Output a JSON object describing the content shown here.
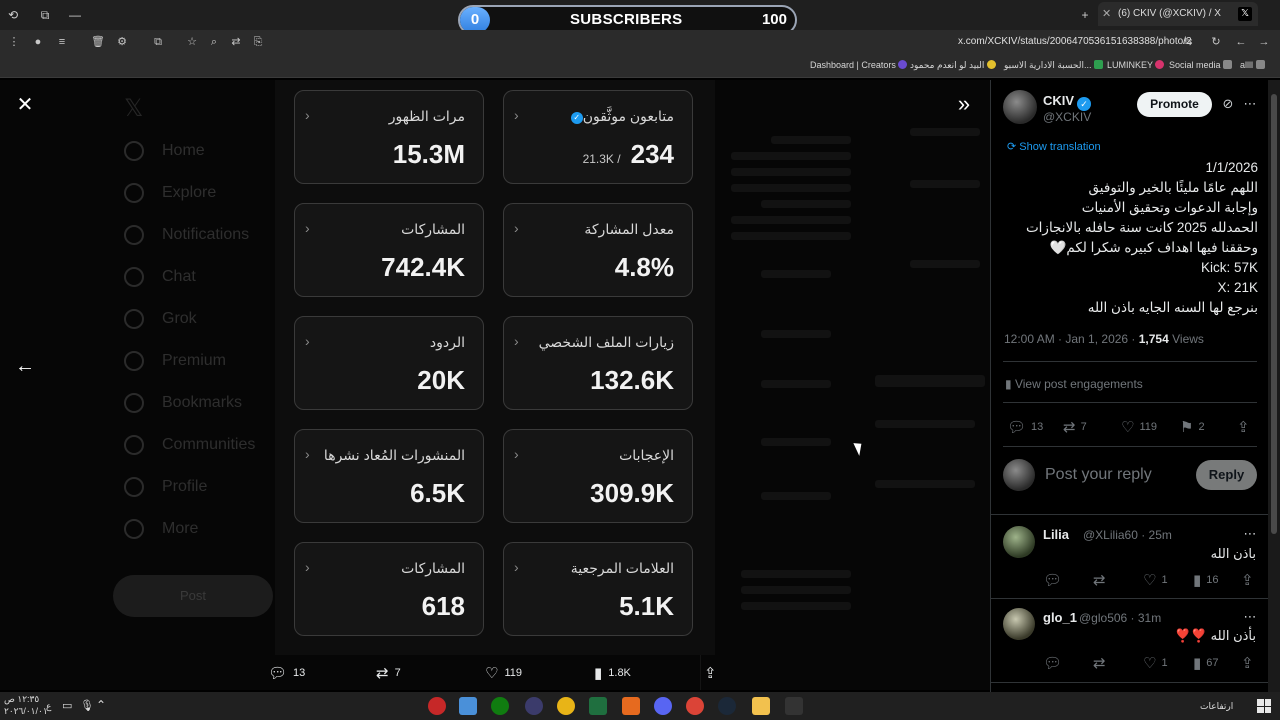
{
  "browser": {
    "subscribers": {
      "count_left": "0",
      "label": "SUBSCRIBERS",
      "count_right": "100"
    },
    "tab_title": "(6) CKIV (@XCKIV) / X",
    "url": "x.com/XCKIV/status/2006470536151638388/photo/2",
    "bookmarks": [
      "Dashboard | Creators",
      "البيد لو انعدم محمود",
      "الحسبة الادارية الاسبو...",
      "LUMINKEY",
      "Social media",
      "allll"
    ]
  },
  "dim_nav": {
    "items": [
      "Home",
      "Explore",
      "Notifications",
      "Chat",
      "Grok",
      "Premium",
      "Bookmarks",
      "Communities",
      "Profile",
      "More"
    ],
    "post_label": "Post"
  },
  "stats": {
    "cards": [
      {
        "label": "مرات الظهور",
        "value": "15.3M"
      },
      {
        "label": "متابعون موثَّقون",
        "value": "234",
        "sub": "21.3K /"
      },
      {
        "label": "المشاركات",
        "value": "742.4K"
      },
      {
        "label": "معدل المشاركة",
        "value": "4.8%"
      },
      {
        "label": "الردود",
        "value": "20K"
      },
      {
        "label": "زيارات الملف الشخصي",
        "value": "132.6K"
      },
      {
        "label": "المنشورات المُعاد نشرها",
        "value": "6.5K"
      },
      {
        "label": "الإعجابات",
        "value": "309.9K"
      },
      {
        "label": "المشاركات",
        "value": "618"
      },
      {
        "label": "العلامات المرجعية",
        "value": "5.1K"
      }
    ]
  },
  "modal_actions": {
    "replies": "13",
    "reposts": "7",
    "likes": "119",
    "views": "1.8K"
  },
  "tweet": {
    "author_name": "CKIV",
    "author_handle": "@XCKIV",
    "promote_label": "Promote",
    "show_translation": "Show translation",
    "lines": [
      "1/1/2026",
      "اللهم عامًا مليئًا بالخير والتوفيق",
      "وإجابة الدعوات وتحقيق الأمنيات",
      "الحمدلله 2025 كانت سنة حافله بالانجازات",
      "وحققنا فيها اهداف كبيره شكرا لكم🤍",
      "Kick: 57K",
      "X: 21K",
      "بنرجع لها السنه الجايه باذن الله"
    ],
    "timestamp": "12:00 AM · Jan 1, 2026 · ",
    "views_count": "1,754",
    "views_label": " Views",
    "engagements_label": "View post engagements",
    "replies": "13",
    "reposts": "7",
    "likes": "119",
    "bookmarks": "2",
    "reply_placeholder": "Post your reply",
    "reply_button": "Reply"
  },
  "replies": [
    {
      "name": "Lilia",
      "handle": "@XLilia60 · 25m",
      "text": "باذن الله",
      "likes": "1",
      "views": "16"
    },
    {
      "name": "glo_1",
      "handle": "@glo506 · 31m",
      "text": "بأذن الله ❣️❣️",
      "likes": "1",
      "views": "67"
    }
  ],
  "taskbar": {
    "time": "١٢:٣٥ ص",
    "date": "٢٠٢٦/٠١/٠١",
    "lang": "ع",
    "weather": "ارتفاعات"
  },
  "colors": {
    "accent": "#1d9bf0",
    "background": "#000000",
    "card_border": "#3a3a3a"
  }
}
